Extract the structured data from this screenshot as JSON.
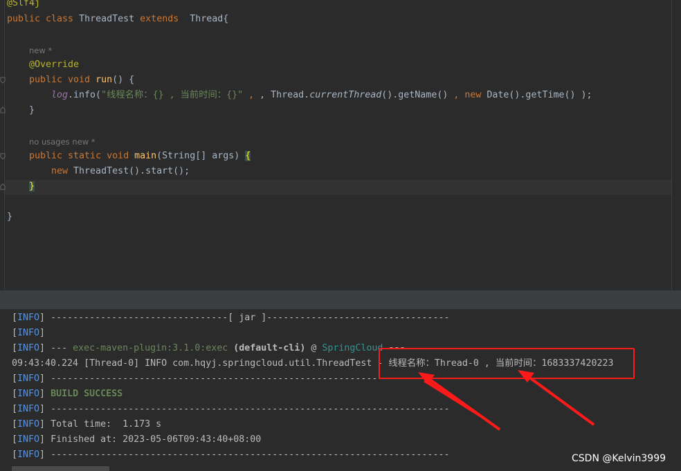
{
  "editor": {
    "lines": {
      "l1": "@Slf4j",
      "l2_kw1": "public class",
      "l2_name": "ThreadTest",
      "l2_kw2": "extends",
      "l2_parent": "Thread{",
      "hint1": "new *",
      "override": "@Override",
      "run_kw": "public void",
      "run_name": "run",
      "run_rest": "() {",
      "log_obj": "log",
      "log_call": ".info(",
      "log_str": "\"线程名称：{} , 当前时间：{}\"",
      "log_sep1": " , Thread.",
      "log_current": "currentThread",
      "log_getname": "().getName() ",
      "log_sep2": ", ",
      "log_new": "new",
      "log_date": " Date().getTime() );",
      "close1": "}",
      "hint2": "no usages   new *",
      "main_kw": "public static void",
      "main_name": "main",
      "main_params": "(String[] args) ",
      "main_brace": "{",
      "start_new": "new",
      "start_rest": " ThreadTest().start();",
      "close2": "}",
      "close3": "}"
    }
  },
  "console": {
    "info_tag": "INFO",
    "l1_rest": " --------------------------------[ jar ]---------------------------------",
    "l3_a": " --- ",
    "l3_plugin": "exec-maven-plugin:3.1.0:exec",
    "l3_b": " (default-cli)",
    "l3_at": " @ ",
    "l3_project": "SpringCloud",
    "l3_c": " ---",
    "log_line": "09:43:40.224 [Thread-0] INFO com.hqyj.springcloud.util.ThreadTest - 线程名称：Thread-0 , 当前时间：1683337420223",
    "dash_line": " ------------------------------------------------------------------------",
    "build": " BUILD SUCCESS",
    "total_time": " Total time:  1.173 s",
    "finished": " Finished at: 2023-05-06T09:43:40+08:00"
  },
  "watermark": "CSDN @Kelvin3999",
  "colors": {
    "annotation_box": "#ff1a1a",
    "arrow": "#ff1a1a",
    "info_blue": "#5394ec",
    "keyword": "#cc7832"
  }
}
